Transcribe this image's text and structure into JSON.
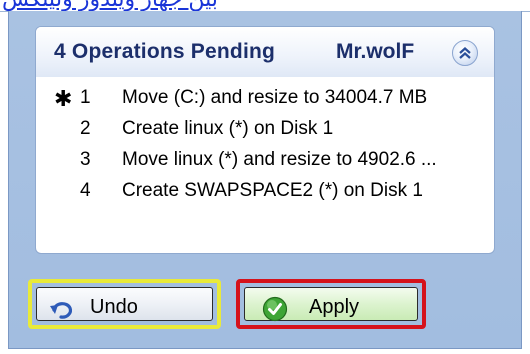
{
  "top_link": {
    "text": "بين جهاز ويندوز ولينكس"
  },
  "panel": {
    "title": "4 Operations Pending",
    "user": "Mr.wolF",
    "operations": [
      {
        "marker": "✱",
        "number": "1",
        "text": "Move  (C:) and resize to 34004.7 MB"
      },
      {
        "marker": "",
        "number": "2",
        "text": "Create linux (*) on Disk 1"
      },
      {
        "marker": "",
        "number": "3",
        "text": "Move linux (*) and resize to 4902.6 ..."
      },
      {
        "marker": "",
        "number": "4",
        "text": "Create SWAPSPACE2 (*) on Disk 1"
      }
    ]
  },
  "buttons": {
    "undo_label": "Undo",
    "apply_label": "Apply"
  },
  "colors": {
    "highlight_undo": "#e9ea3a",
    "highlight_apply": "#d5121b",
    "panel_bg": "#a9c2e2",
    "title_text": "#1c2f6b"
  },
  "icons": {
    "collapse": "double-chevron-up-icon",
    "undo": "undo-arrow-icon",
    "apply": "green-check-icon"
  }
}
